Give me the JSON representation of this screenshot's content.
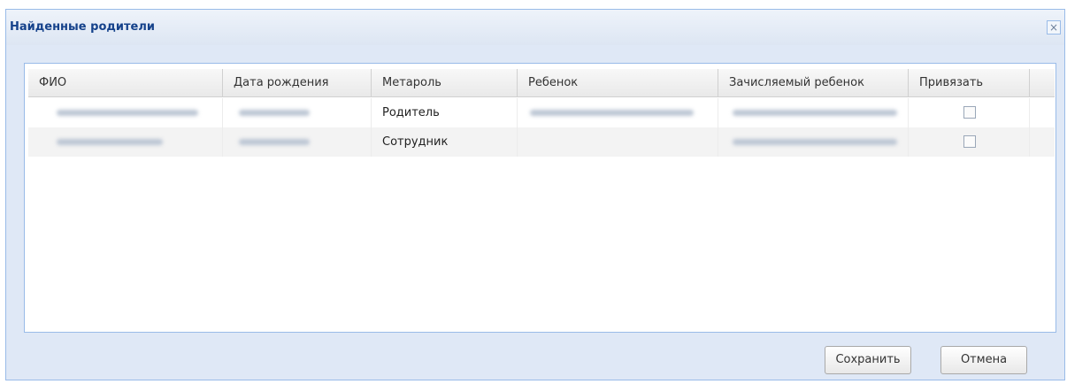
{
  "dialog": {
    "title": "Найденные родители",
    "close_glyph": "×"
  },
  "grid": {
    "columns": [
      "ФИО",
      "Дата рождения",
      "Метароль",
      "Ребенок",
      "Зачисляемый ребенок",
      "Привязать"
    ],
    "rows": [
      {
        "metarole": "Родитель"
      },
      {
        "metarole": "Сотрудник"
      }
    ]
  },
  "buttons": {
    "save": "Сохранить",
    "cancel": "Отмена"
  }
}
